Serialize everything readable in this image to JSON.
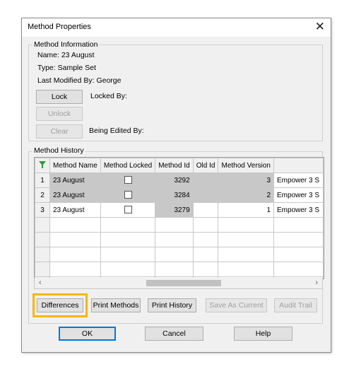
{
  "dialog": {
    "title": "Method Properties",
    "close_glyph": "✕"
  },
  "info": {
    "legend": "Method Information",
    "name_line": "Name:  23 August",
    "type_line": "Type:   Sample Set",
    "modified_line": "Last Modified By:  George",
    "lock_label": "Lock",
    "locked_by_label": "Locked By:",
    "unlock_label": "Unlock",
    "clear_label": "Clear",
    "editing_by_label": "Being Edited By:"
  },
  "history": {
    "legend": "Method History",
    "header_icon": "filter-icon",
    "columns": [
      "Method Name",
      "Method Locked",
      "Method Id",
      "Old Id",
      "Method Version",
      ""
    ],
    "rows": [
      {
        "num": "1",
        "name": "23 August",
        "locked": false,
        "id": "3292",
        "old_id": "",
        "version": "3",
        "extra": "Empower 3 S"
      },
      {
        "num": "2",
        "name": "23 August",
        "locked": false,
        "id": "3284",
        "old_id": "",
        "version": "2",
        "extra": "Empower 3 S"
      },
      {
        "num": "3",
        "name": "23 August",
        "locked": false,
        "id": "3279",
        "old_id": "",
        "version": "1",
        "extra": "Empower 3 S"
      }
    ],
    "scroll_left": "‹",
    "scroll_right": "›"
  },
  "actions": {
    "differences": "Differences",
    "print_methods": "Print Methods",
    "print_history": "Print History",
    "save_as_current": "Save As Current",
    "audit_trail": "Audit Trail"
  },
  "footer": {
    "ok": "OK",
    "cancel": "Cancel",
    "help": "Help"
  },
  "colors": {
    "highlight": "#f5b800",
    "filter_icon": "#2e9a3a",
    "selected_row": "#c8c8c8"
  }
}
